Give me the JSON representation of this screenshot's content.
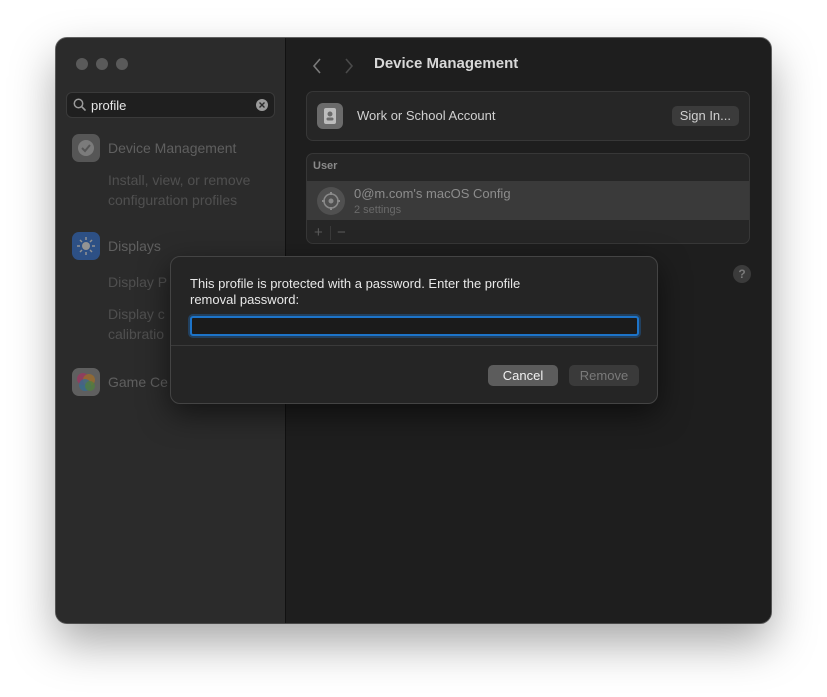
{
  "sidebar": {
    "search": {
      "value": "profile",
      "placeholder": "Search"
    },
    "results": [
      {
        "title": "Device Management",
        "sub": [
          "Install, view, or remove",
          "configuration profiles"
        ]
      },
      {
        "title": "Displays",
        "sub": [
          "Display P",
          "Display c",
          "calibratio"
        ]
      },
      {
        "title": "Game Ce"
      }
    ]
  },
  "main": {
    "title": "Device Management",
    "account": {
      "label": "Work or School Account",
      "button": "Sign In..."
    },
    "user_section": {
      "header": "User",
      "profile": {
        "name": "0@m.com's macOS Config",
        "sub": "2 settings"
      },
      "add": "+",
      "remove": "−"
    },
    "help": "?"
  },
  "dialog": {
    "message": "This profile is protected with a password. Enter the profile removal password:",
    "input_value": "",
    "cancel": "Cancel",
    "remove": "Remove"
  },
  "colors": {
    "accent": "#1d74c9",
    "window_bg": "#1e1e1e",
    "sidebar_bg": "#2b2b2b"
  }
}
